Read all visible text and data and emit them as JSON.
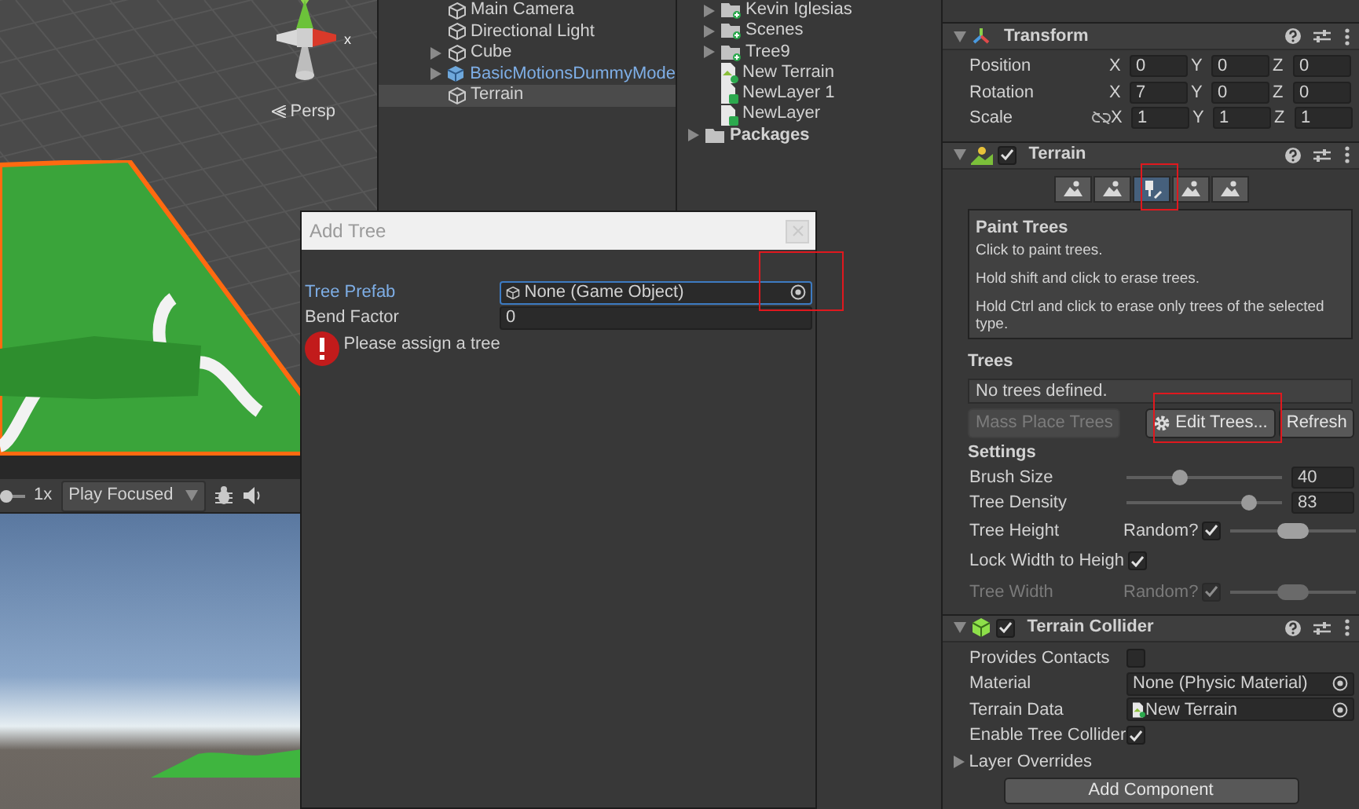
{
  "scene": {
    "gizmo_label": "x",
    "camera_label": "Persp"
  },
  "game_toolbar": {
    "scale_slider": {
      "level": 0
    },
    "scale_label": "1x",
    "play_mode": "Play Focused"
  },
  "hierarchy": [
    {
      "label": "Main Camera",
      "kind": "object",
      "expandable": false,
      "selected": false
    },
    {
      "label": "Directional Light",
      "kind": "object",
      "expandable": false,
      "selected": false
    },
    {
      "label": "Cube",
      "kind": "object",
      "expandable": true,
      "selected": false
    },
    {
      "label": "BasicMotionsDummyMode",
      "kind": "prefab",
      "expandable": true,
      "selected": false
    },
    {
      "label": "Terrain",
      "kind": "object",
      "expandable": false,
      "selected": true
    }
  ],
  "project": [
    {
      "label": "Kevin Iglesias",
      "kind": "folder",
      "expandable": true
    },
    {
      "label": "Scenes",
      "kind": "folder",
      "expandable": true
    },
    {
      "label": "Tree9",
      "kind": "folder",
      "expandable": true
    },
    {
      "label": "New Terrain",
      "kind": "terrain",
      "expandable": false
    },
    {
      "label": "NewLayer 1",
      "kind": "file",
      "expandable": false
    },
    {
      "label": "NewLayer",
      "kind": "file",
      "expandable": false
    },
    {
      "label": "Packages",
      "kind": "root",
      "expandable": true
    }
  ],
  "dialog": {
    "title": "Add Tree",
    "fields": [
      {
        "label": "Tree Prefab",
        "value": "None (Game Object)",
        "kind": "object",
        "focused": true
      },
      {
        "label": "Bend Factor",
        "value": "0",
        "kind": "number",
        "focused": false
      }
    ],
    "error": "Please assign a tree"
  },
  "inspector": {
    "transform": {
      "title": "Transform",
      "rows": [
        {
          "label": "Position",
          "kind": "vector",
          "values": [
            {
              "axis": "X",
              "value": "0"
            },
            {
              "axis": "Y",
              "value": "0"
            },
            {
              "axis": "Z",
              "value": "0"
            }
          ]
        },
        {
          "label": "Rotation",
          "kind": "vector",
          "values": [
            {
              "axis": "X",
              "value": "7"
            },
            {
              "axis": "Y",
              "value": "0"
            },
            {
              "axis": "Z",
              "value": "0"
            }
          ]
        },
        {
          "label": "Scale",
          "kind": "vector-link",
          "values": [
            {
              "axis": "X",
              "value": "1"
            },
            {
              "axis": "Y",
              "value": "1"
            },
            {
              "axis": "Z",
              "value": "1"
            }
          ]
        }
      ]
    },
    "terrain": {
      "title": "Terrain",
      "enabled": true,
      "tools": [
        {
          "selected": false
        },
        {
          "selected": false
        },
        {
          "selected": true
        },
        {
          "selected": false
        },
        {
          "selected": false
        }
      ],
      "help_title": "Paint Trees",
      "help_lines": [
        "Click to paint trees.",
        "Hold shift and click to erase trees.",
        "Hold Ctrl and click to erase only trees of the selected type."
      ],
      "trees_heading": "Trees",
      "trees_list": "No trees defined.",
      "buttons": [
        {
          "label": "Mass Place Trees",
          "disabled": true
        },
        {
          "label": "Edit Trees...",
          "disabled": false
        },
        {
          "label": "Refresh",
          "disabled": false
        }
      ],
      "settings_heading": "Settings",
      "settings": [
        {
          "kind": "slider",
          "label": "Brush Size",
          "level": 0.34,
          "value": "40",
          "disabled": false
        },
        {
          "kind": "slider",
          "label": "Tree Density",
          "level": 0.79,
          "value": "83",
          "disabled": false
        },
        {
          "kind": "random",
          "label": "Tree Height",
          "option": "Random?",
          "checked": true,
          "level": 0.5,
          "disabled": false
        },
        {
          "kind": "toggle",
          "label": "Lock Width to Heigh",
          "checked": true,
          "disabled": false
        },
        {
          "kind": "random",
          "label": "Tree Width",
          "option": "Random?",
          "checked": true,
          "level": 0.5,
          "disabled": true
        }
      ]
    },
    "collider": {
      "title": "Terrain Collider",
      "enabled": true,
      "rows": [
        {
          "kind": "toggle",
          "label": "Provides Contacts",
          "checked": false
        },
        {
          "kind": "object",
          "label": "Material",
          "value": "None (Physic Material)"
        },
        {
          "kind": "asset",
          "label": "Terrain Data",
          "value": "New Terrain"
        },
        {
          "kind": "toggle",
          "label": "Enable Tree Collider",
          "checked": true
        },
        {
          "kind": "foldout",
          "label": "Layer Overrides"
        }
      ]
    },
    "add_button": "Add Component"
  }
}
